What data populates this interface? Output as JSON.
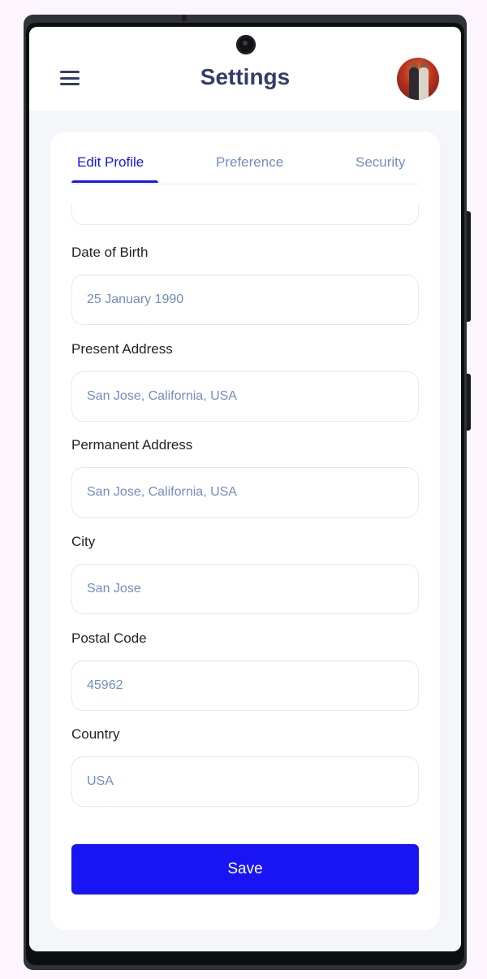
{
  "header": {
    "title": "Settings"
  },
  "tabs": [
    {
      "label": "Edit Profile",
      "active": true
    },
    {
      "label": "Preference",
      "active": false
    },
    {
      "label": "Security",
      "active": false
    }
  ],
  "form": {
    "password": {
      "value": "*********"
    },
    "dob": {
      "label": "Date of Birth",
      "value": "25 January 1990"
    },
    "present_address": {
      "label": "Present Address",
      "value": "San Jose, California, USA"
    },
    "permanent_address": {
      "label": "Permanent Address",
      "value": "San Jose, California, USA"
    },
    "city": {
      "label": "City",
      "value": "San Jose"
    },
    "postal_code": {
      "label": "Postal Code",
      "value": "45962"
    },
    "country": {
      "label": "Country",
      "value": "USA"
    }
  },
  "save_label": "Save",
  "colors": {
    "accent": "#1814f3",
    "title": "#343c6a",
    "muted": "#718ebf",
    "background": "#f5f6fa"
  }
}
